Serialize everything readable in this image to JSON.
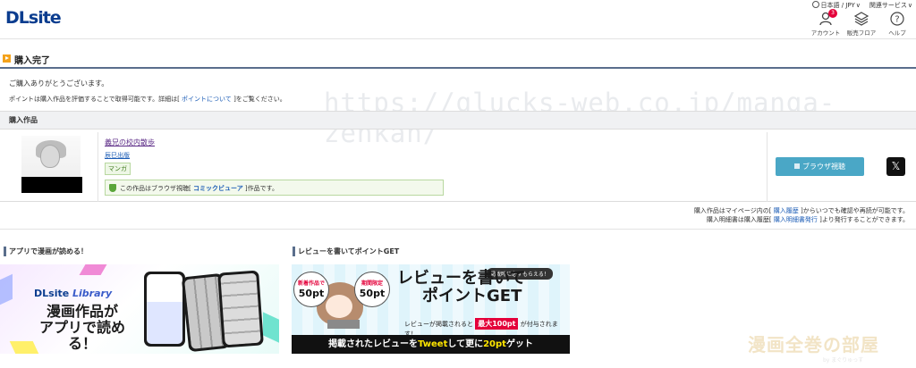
{
  "header": {
    "logo": "DLsite",
    "language": "日本語 / JPY",
    "related": "関連サービス",
    "icons": [
      {
        "name": "account-icon",
        "label": "アカウント",
        "badge": "3"
      },
      {
        "name": "floor-icon",
        "label": "販売フロア"
      },
      {
        "name": "help-icon",
        "label": "ヘルプ"
      }
    ]
  },
  "complete": {
    "title": "購入完了",
    "thanks": "ご購入ありがとうございます。",
    "points_pre": "ポイントは購入作品を評価することで取得可能です。詳細は[ ",
    "points_link": "ポイントについて",
    "points_post": " ]をご覧ください。"
  },
  "watermark": "https://glucks-web.co.jp/manga-zenkan/",
  "purchased": {
    "heading": "購入作品",
    "item": {
      "title": "義兄の校内散歩",
      "circle": "辰巳出版",
      "genre": "マンガ",
      "note_pre": "この作品はブラウザ視聴[ ",
      "note_link": "コミックビューア",
      "note_post": " ]作品です。",
      "browse_button": "ブラウザ視聴",
      "share_button": "𝕏"
    },
    "history_line1_pre": "購入作品はマイページ内の[ ",
    "history_line1_link": "購入履歴",
    "history_line1_post": " ]からいつでも確認や再読が可能です。",
    "history_line2_pre": "購入明細書は購入履歴[ ",
    "history_line2_link": "購入明細書発行",
    "history_line2_post": " ]より発行することができます。"
  },
  "banners": {
    "left_heading": "アプリで漫画が読める！",
    "left_logo": "DLsite",
    "left_logo_sub": "Library",
    "left_line1": "漫画作品が",
    "left_line2": "アプリで読める！",
    "right_heading": "レビューを書いてポイントGET",
    "bubble1_top": "新着作品で",
    "bubble1_pt": "50pt",
    "bubble2_top": "期間限定",
    "bubble2_pt": "50pt",
    "badge": "掲載時に必ずもらえる！",
    "title_line1": "レビューを書いて",
    "title_line2": "ポイントGET",
    "sub_pre": "レビューが掲載されると ",
    "sub_max": "最大100pt",
    "sub_post": " が付与されます！",
    "foot_pre": "掲載されたレビューを",
    "foot_hl1": "Tweet",
    "foot_mid": "して更に",
    "foot_hl2": "20pt",
    "foot_post": "ゲット"
  },
  "corner": {
    "logo": "漫画全巻の部屋",
    "sub": "by まぐりゅっす"
  }
}
